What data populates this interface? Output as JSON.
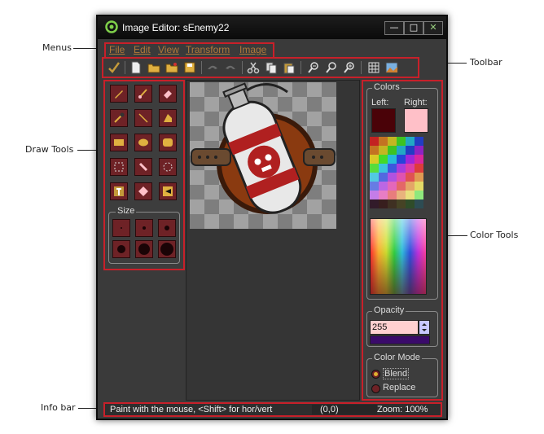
{
  "window": {
    "title": "Image Editor: sEnemy22"
  },
  "callouts": {
    "menus": "Menus",
    "toolbar": "Toolbar",
    "draw_tools": "Draw Tools",
    "color_tools": "Color Tools",
    "info_bar": "Info bar"
  },
  "menu": [
    "File",
    "Edit",
    "View",
    "Transform",
    "Image"
  ],
  "size_label": "Size",
  "colors": {
    "group_label": "Colors",
    "left_label": "Left:",
    "right_label": "Right:",
    "left_color": "#4a0208",
    "right_color": "#ffc0c8"
  },
  "opacity": {
    "label": "Opacity",
    "value": "255",
    "bar_color": "#3a0a6a"
  },
  "color_mode": {
    "label": "Color Mode",
    "blend": "Blend",
    "replace": "Replace",
    "selected": "Blend"
  },
  "info": {
    "hint": "Paint with the mouse, <Shift> for hor/vert",
    "coords": "(0,0)",
    "zoom": "Zoom: 100%"
  },
  "accent": "#c8202a"
}
